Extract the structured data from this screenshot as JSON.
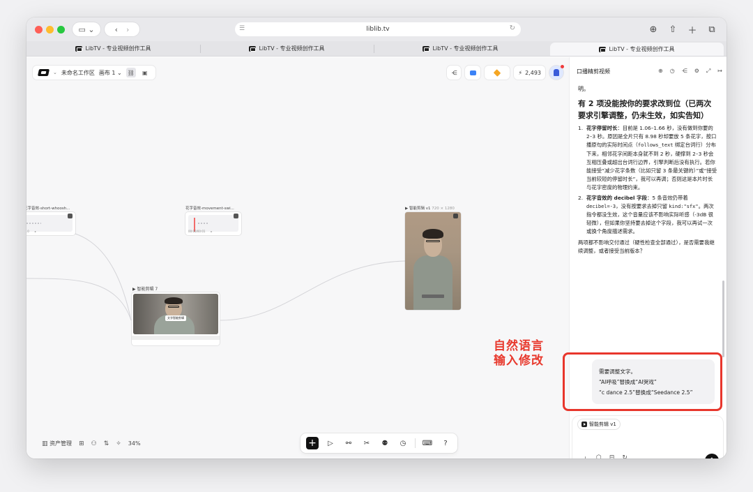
{
  "browser": {
    "url": "liblib.tv",
    "tabs": [
      {
        "title": "LibTV - 专业视频创作工具"
      },
      {
        "title": "LibTV - 专业视频创作工具"
      },
      {
        "title": "LibTV - 专业视频创作工具"
      },
      {
        "title": "LibTV - 专业视频创作工具"
      }
    ]
  },
  "workspace": {
    "name": "未命名工作区",
    "canvas_name": "画布 1",
    "credits": "2,493",
    "zoom": "34%",
    "asset_manager": "资产管理"
  },
  "nodes": {
    "audio1_label": "花字音效-short-whoosh...",
    "audio2_label": "花字音效-movement-swi...",
    "video_right_label": "▶ 智能剪辑 v1",
    "video_right_meta": "720 × 1280",
    "video_center_label": "▶ 智能剪辑 7",
    "edit_chip": "文字智能剪辑"
  },
  "annotation": {
    "line1": "自然语言",
    "line2": "输入修改"
  },
  "panel": {
    "title": "口播精剪视频",
    "intro_tail": "明。",
    "heading": "有 2 项没能按你的要求改到位（已两次要求引擎调整，仍未生效，如实告知）",
    "items": [
      {
        "num": "1.",
        "bold": "花字停留时长",
        "text1": "：目前是 1.06–1.66 秒，没有做到你要的 2–3 秒。原因是全片只有 8.98 秒却要放 5 条花字，按口播原句的实际时间点（",
        "code": "follows_text",
        "text2": " 绑定台词行）分布下来，相邻花字间距本身就不到 2 秒，硬撑到 2–3 秒会互相压叠或超出台词行边界，引擎判断后没有执行。若你能接受“减少花字条数（比如只留 3 条最关键的）”或“接受当前较短的停留时长”，我可以再调；否则这是本片时长与花字密度的物理约束。"
      },
      {
        "num": "2.",
        "bold": "花字音效的 decibel 字段",
        "text1": "：5 条音效仍带着 ",
        "code": "decibel=-3",
        "text2": "，没有按要求去掉只留 ",
        "code2": "kind:\"sfx\"",
        "text3": "。两次指令都没生效，这个音量应该不影响实际听感（-3dB 很轻微），但如果你坚持要去掉这个字段，我可以再试一次或换个角度描述需求。"
      }
    ],
    "conclusion": "两项都不影响交付通过（硬性检查全部通过），是否需要我继续调整，或者接受当前版本？",
    "user_message": {
      "line1": "需要调整文字。",
      "line2": "“AI呼吸”替换成“AI哭戏”",
      "line3": "“c dance 2.5”替换成“Seedance 2.5”"
    },
    "input_chip": "智能剪辑 v1"
  },
  "colors": {
    "annotation_red": "#e83a2e",
    "accent_orange": "#f5a623",
    "accent_blue": "#3b82f6"
  }
}
